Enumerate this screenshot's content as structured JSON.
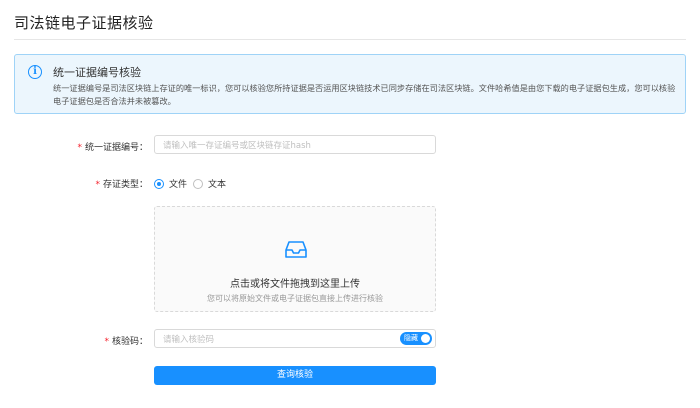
{
  "page": {
    "title": "司法链电子证据核验"
  },
  "info": {
    "title": "统一证据编号核验",
    "description": "统一证据编号是司法区块链上存证的唯一标识，您可以核验您所持证据是否运用区块链技术已同步存储在司法区块链。文件哈希值是由您下载的电子证据包生成，您可以核验电子证据包是否合法并未被篡改。"
  },
  "form": {
    "evidence_id": {
      "label": "统一证据编号：",
      "placeholder": "请输入唯一存证编号或区块链存证hash"
    },
    "type": {
      "label": "存证类型：",
      "options": [
        {
          "label": "文件",
          "checked": true
        },
        {
          "label": "文本",
          "checked": false
        }
      ]
    },
    "upload": {
      "main_text": "点击或将文件拖拽到这里上传",
      "hint_text": "您可以将原始文件或电子证据包直接上传进行核验"
    },
    "code": {
      "label": "核验码：",
      "placeholder": "请输入核验码",
      "toggle_label": "隐藏"
    },
    "submit_label": "查询核验"
  },
  "colors": {
    "primary": "#1890ff",
    "required": "#f5222d",
    "info_bg": "#ecf6fd",
    "info_border": "#9fd3f7"
  }
}
